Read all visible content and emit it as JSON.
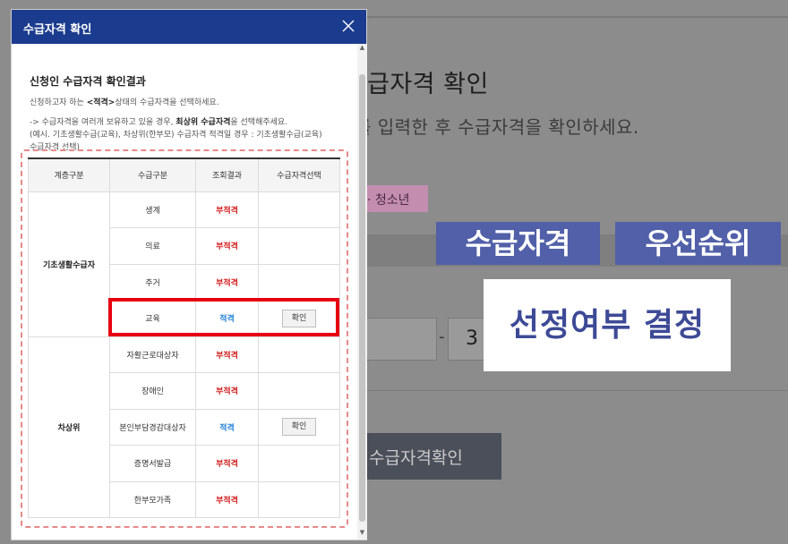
{
  "background": {
    "title": "급자격 확인",
    "description": "를 입력한 후 수급자격을 확인하세요.",
    "tag": "· 청소년",
    "field_value": "3",
    "dash": "-",
    "button_label": "수급자격확인"
  },
  "captions": {
    "qualification": "수급자격",
    "priority": "우선순위",
    "selection": "선정여부 결정"
  },
  "modal": {
    "title": "수급자격 확인",
    "section_title": "신청인 수급자격 확인결과",
    "info_line1_pre": "신청하고자 하는 ",
    "info_line1_bold": "<적격>",
    "info_line1_post": "상태의 수급자격을 선택하세요.",
    "info_line2_pre": "-> 수급자격을 여러개 보유하고 있을 경우, ",
    "info_line2_bold": "최상위 수급자격",
    "info_line2_post": "을 선택해주세요.",
    "info_line3": "(예시. 기초생활수급(교육), 차상위(한부모) 수급자격 적격일 경우 : 기초생활수급(교육)",
    "info_line4": "수급자격 선택)",
    "table": {
      "headers": [
        "계층구분",
        "수급구분",
        "조회결과",
        "수급자격선택"
      ],
      "groups": [
        {
          "name": "기초생활수급자",
          "rows": [
            {
              "type": "생계",
              "result": "부적격",
              "status": "fail",
              "button": ""
            },
            {
              "type": "의료",
              "result": "부적격",
              "status": "fail",
              "button": ""
            },
            {
              "type": "주거",
              "result": "부적격",
              "status": "fail",
              "button": ""
            },
            {
              "type": "교육",
              "result": "적격",
              "status": "pass",
              "button": "확인"
            }
          ]
        },
        {
          "name": "차상위",
          "rows": [
            {
              "type": "자활근로대상자",
              "result": "부적격",
              "status": "fail",
              "button": ""
            },
            {
              "type": "장애인",
              "result": "부적격",
              "status": "fail",
              "button": ""
            },
            {
              "type": "본인부담경감대상자",
              "result": "적격",
              "status": "pass",
              "button": "확인"
            },
            {
              "type": "증명서발급",
              "result": "부적격",
              "status": "fail",
              "button": ""
            },
            {
              "type": "한부모가족",
              "result": "부적격",
              "status": "fail",
              "button": ""
            }
          ]
        }
      ]
    }
  },
  "colors": {
    "modal_header": "#1b3c8e",
    "fail": "#d11a1a",
    "pass": "#1e7fd6",
    "highlight": "#e60012",
    "caption_blue": "#5160a8"
  },
  "icons": {
    "close": "close-icon",
    "scroll_up": "chevron-up-icon",
    "scroll_down": "chevron-down-icon"
  }
}
